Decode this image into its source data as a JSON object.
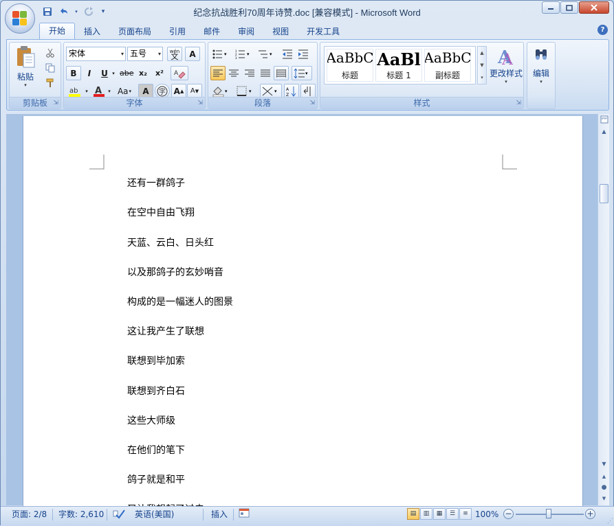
{
  "window": {
    "title": "纪念抗战胜利70周年诗赞.doc [兼容模式] - Microsoft Word"
  },
  "tabs": [
    "开始",
    "插入",
    "页面布局",
    "引用",
    "邮件",
    "审阅",
    "视图",
    "开发工具"
  ],
  "ribbon": {
    "clipboard": {
      "paste_label": "粘贴",
      "group_label": "剪贴板"
    },
    "font": {
      "font_name": "宋体",
      "font_size": "五号",
      "group_label": "字体",
      "wen_label": "wén\n文",
      "bold": "B",
      "italic": "I",
      "underline": "U",
      "strike": "abe",
      "subscript": "x₂",
      "superscript": "x²",
      "case": "Aa",
      "grow": "A",
      "shrink": "A"
    },
    "paragraph": {
      "group_label": "段落"
    },
    "styles": {
      "group_label": "样式",
      "items": [
        {
          "sample": "AaBbC",
          "name": "标题"
        },
        {
          "sample": "AaBl",
          "name": "标题 1"
        },
        {
          "sample": "AaBbC",
          "name": "副标题"
        }
      ],
      "change_styles": "更改样式"
    },
    "editing": {
      "label": "编辑"
    }
  },
  "document": {
    "lines": [
      "还有一群鸽子",
      "在空中自由飞翔",
      "天蓝、云白、日头红",
      "以及那鸽子的玄妙哨音",
      "构成的是一幅迷人的图景",
      "这让我产生了联想",
      "联想到毕加索",
      "联想到齐白石",
      "这些大师级",
      "在他们的笔下",
      "鸽子就是和平",
      "又让我想起了过去"
    ]
  },
  "status": {
    "page": "页面: 2/8",
    "words": "字数: 2,610",
    "language": "英语(美国)",
    "mode": "插入",
    "zoom": "100%",
    "zoom_minus": "−",
    "zoom_plus": "+"
  }
}
